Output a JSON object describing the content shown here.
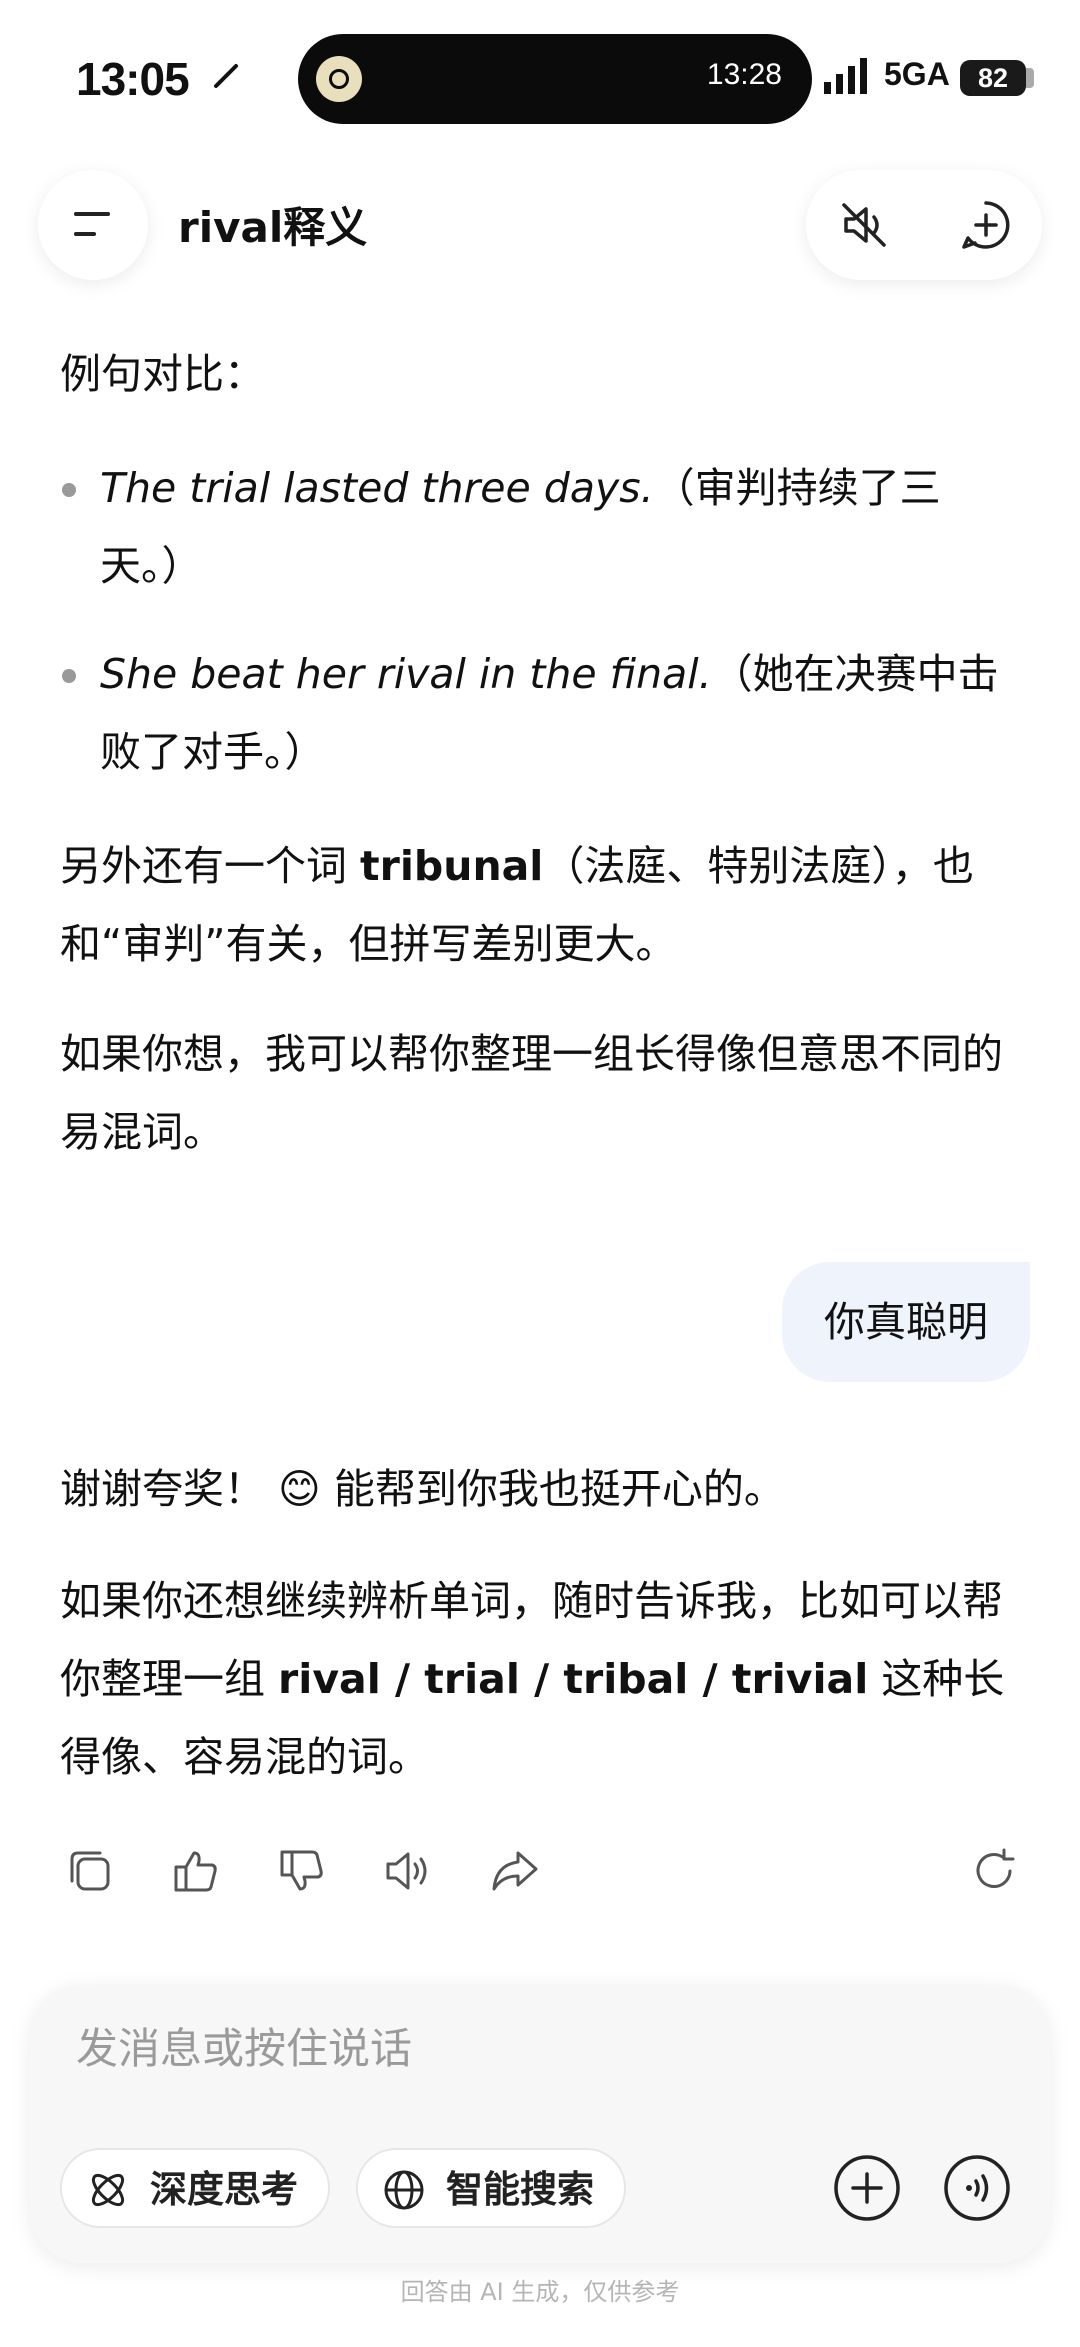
{
  "status_bar": {
    "time": "13:05",
    "island_time": "13:28",
    "network": "5GA",
    "battery": "82"
  },
  "header": {
    "title": "rival释义"
  },
  "messages": {
    "a1_intro": "例句对比：",
    "a1_b1_en": "The trial lasted three days.",
    "a1_b1_zh": "（审判持续了三天。）",
    "a1_b2_en": "She beat her rival in the final.",
    "a1_b2_zh": "（她在决赛中击败了对手。）",
    "a1_p2_pre": "另外还有一个词 ",
    "a1_p2_bold": "tribunal",
    "a1_p2_post": "（法庭、特别法庭），也和“审判”有关，但拼写差别更大。",
    "a1_p3": "如果你想，我可以帮你整理一组长得像但意思不同的易混词。",
    "user_msg": "你真聪明",
    "a2_p1_pre": "谢谢夸奖！",
    "a2_emoji": "😊",
    "a2_p1_post": " 能帮到你我也挺开心的。",
    "a2_p2_pre": "如果你还想继续辨析单词，随时告诉我，比如可以帮你整理一组 ",
    "a2_p2_bold": "rival / trial / tribal / trivial",
    "a2_p2_post": " 这种长得像、容易混的词。"
  },
  "action_icons": [
    "copy-icon",
    "thumbs-up-icon",
    "thumbs-down-icon",
    "speaker-icon",
    "share-icon",
    "regenerate-icon"
  ],
  "composer": {
    "placeholder": "发消息或按住说话",
    "deep_think": "深度思考",
    "smart_search": "智能搜索"
  },
  "disclaimer": "回答由 AI 生成，仅供参考"
}
